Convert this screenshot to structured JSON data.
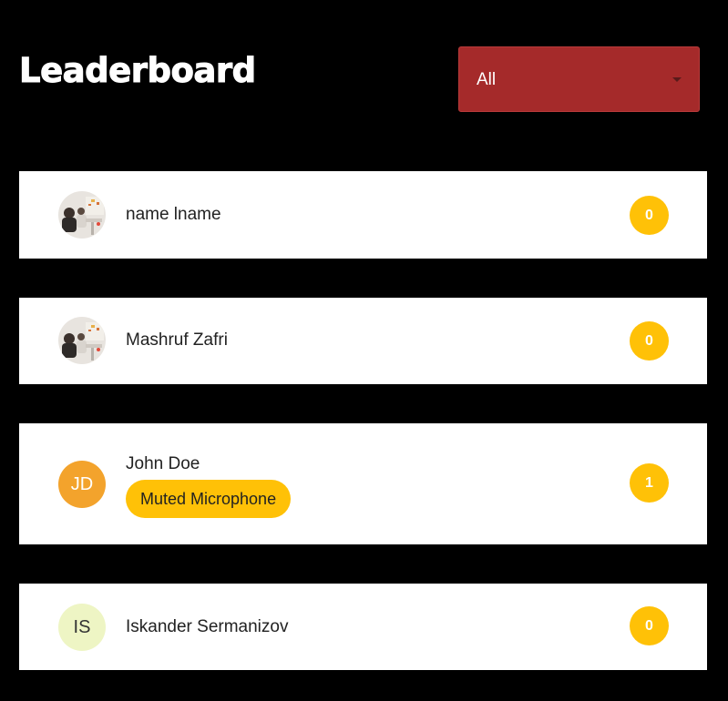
{
  "page": {
    "title": "Leaderboard"
  },
  "filter": {
    "selected": "All",
    "icon": "chevron-down-icon"
  },
  "colors": {
    "background": "#000000",
    "filter_bg": "#a52a2a",
    "badge": "#ffc107",
    "avatar_jd": "#f3a32c",
    "avatar_is": "#eef5c4"
  },
  "entries": [
    {
      "name": "name lname",
      "avatar": "photo",
      "score": "0"
    },
    {
      "name": "Mashruf Zafri",
      "avatar": "photo",
      "score": "0"
    },
    {
      "name": "John Doe",
      "avatar": "initials",
      "initials": "JD",
      "tag": "Muted Microphone",
      "score": "1"
    },
    {
      "name": "Iskander Sermanizov",
      "avatar": "initials",
      "initials": "IS",
      "score": "0"
    }
  ]
}
